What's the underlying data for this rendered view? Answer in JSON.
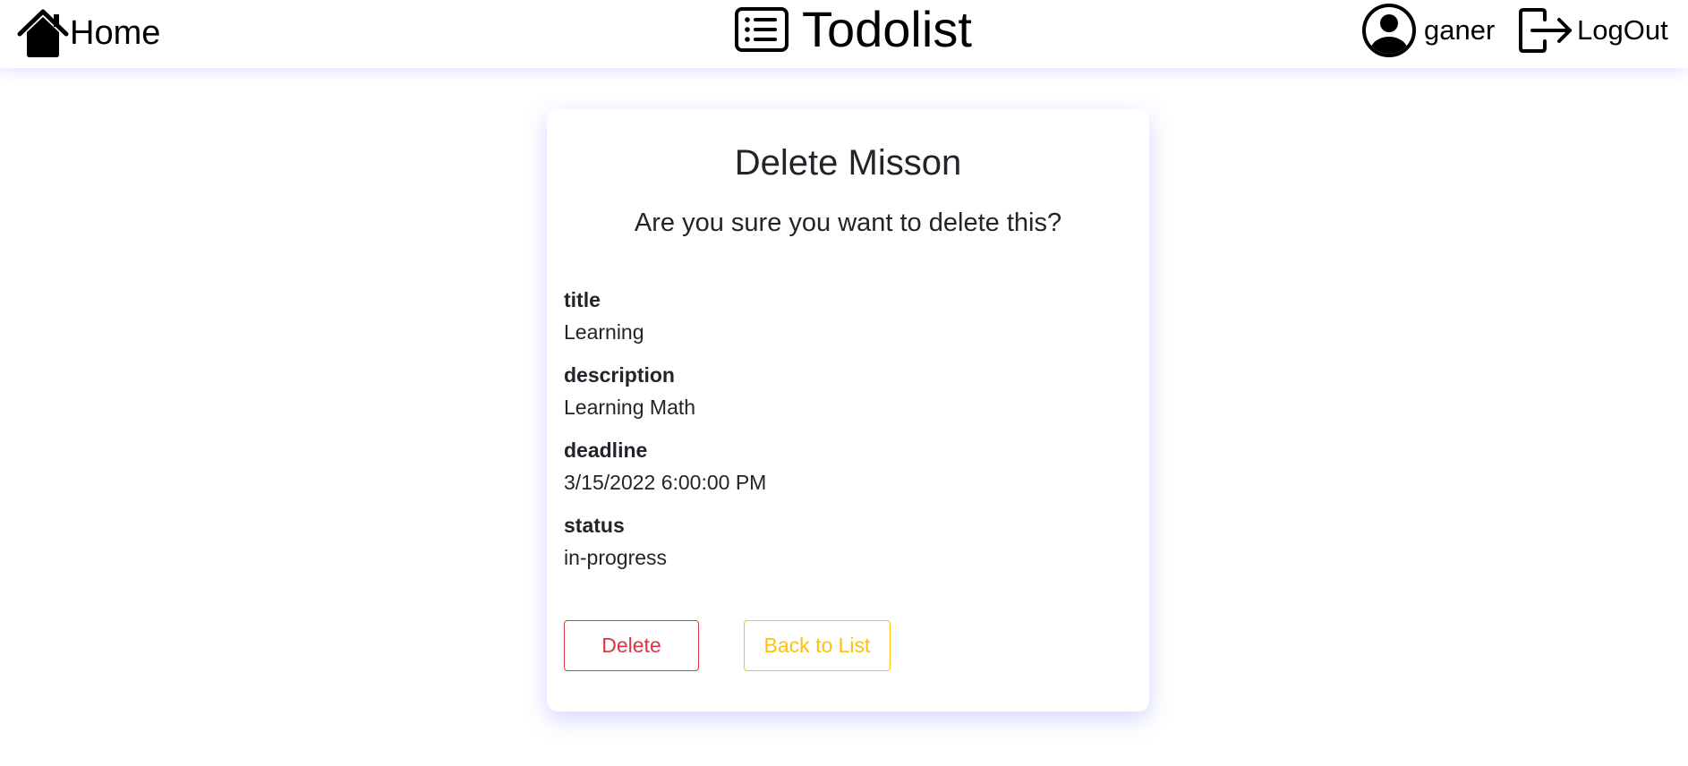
{
  "navbar": {
    "home_label": "Home",
    "home_icon": "house-icon",
    "brand_label": "Todolist",
    "brand_icon": "list-icon",
    "user_name": "ganer",
    "user_icon": "user-circle-icon",
    "logout_label": "LogOut",
    "logout_icon": "logout-icon"
  },
  "card": {
    "title": "Delete Misson",
    "subtitle": "Are you sure you want to delete this?",
    "fields": [
      {
        "label": "title",
        "value": "Learning"
      },
      {
        "label": "description",
        "value": "Learning Math"
      },
      {
        "label": "deadline",
        "value": "3/15/2022 6:00:00 PM"
      },
      {
        "label": "status",
        "value": "in-progress"
      }
    ],
    "delete_label": "Delete",
    "back_label": "Back to List"
  },
  "colors": {
    "delete": "#dc3545",
    "back": "#ffc107",
    "text": "#212529",
    "shadow": "#7882ff"
  }
}
